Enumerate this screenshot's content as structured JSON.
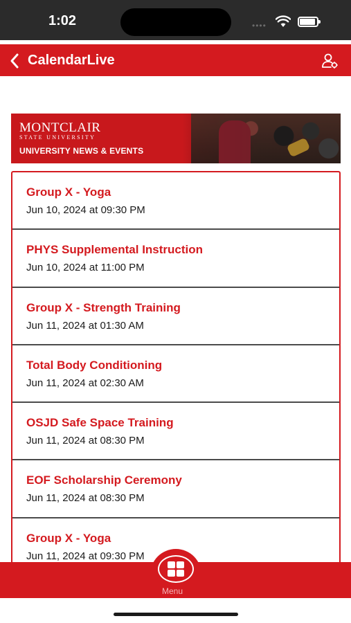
{
  "status_bar": {
    "time": "1:02"
  },
  "nav": {
    "title": "CalendarLive",
    "back_icon": "chevron-left-icon",
    "account_icon": "account-icon"
  },
  "banner": {
    "logo_main": "MONTCLAIR",
    "logo_sub": "STATE UNIVERSITY",
    "tagline": "UNIVERSITY NEWS & EVENTS"
  },
  "events": [
    {
      "title": "Group X - Yoga",
      "date": "Jun 10, 2024 at 09:30 PM"
    },
    {
      "title": "PHYS Supplemental Instruction",
      "date": "Jun 10, 2024 at 11:00 PM"
    },
    {
      "title": "Group X - Strength Training",
      "date": "Jun 11, 2024 at 01:30 AM"
    },
    {
      "title": "Total Body Conditioning",
      "date": "Jun 11, 2024 at 02:30 AM"
    },
    {
      "title": "OSJD Safe Space Training",
      "date": "Jun 11, 2024 at 08:30 PM"
    },
    {
      "title": "EOF Scholarship Ceremony",
      "date": "Jun 11, 2024 at 08:30 PM"
    },
    {
      "title": "Group X - Yoga",
      "date": "Jun 11, 2024 at 09:30 PM"
    }
  ],
  "tab_bar": {
    "menu_label": "Menu",
    "menu_icon": "grid-icon"
  },
  "colors": {
    "brand_red": "#d41a1f",
    "status_bar": "#2b2b2b"
  }
}
